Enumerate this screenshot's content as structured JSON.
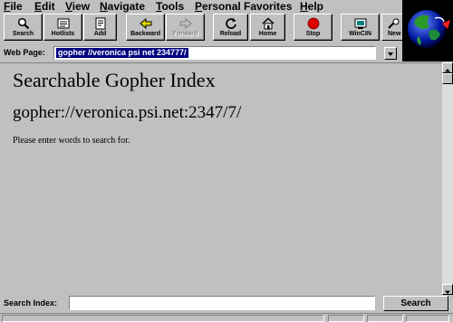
{
  "menu": {
    "file": {
      "u": "F",
      "rest": "ile"
    },
    "edit": {
      "u": "E",
      "rest": "dit"
    },
    "view": {
      "u": "V",
      "rest": "iew"
    },
    "navigate": {
      "u": "N",
      "rest": "avigate"
    },
    "tools": {
      "u": "T",
      "rest": "ools"
    },
    "personal_favorites": {
      "u": "P",
      "rest": "ersonal Favorites"
    },
    "help": {
      "u": "H",
      "rest": "elp"
    }
  },
  "toolbar": {
    "search": "Search",
    "hotlists": "Hotlists",
    "add": "Add",
    "backward": "Backward",
    "forward": "Forward",
    "reload": "Reload",
    "home": "Home",
    "stop": "Stop",
    "wincim": "WinCIN",
    "news": "New"
  },
  "address": {
    "label": "Web Page:",
    "value": "gopher //veronica psi net 234777/"
  },
  "page": {
    "heading": "Searchable Gopher Index",
    "url": "gopher://veronica.psi.net:2347/7/",
    "prompt": "Please enter words to search for."
  },
  "search": {
    "label": "Search Index:",
    "value": "",
    "button": "Search"
  },
  "colors": {
    "chrome": "#c0c0c0",
    "selection": "#000080",
    "stop_red": "#e00000"
  }
}
